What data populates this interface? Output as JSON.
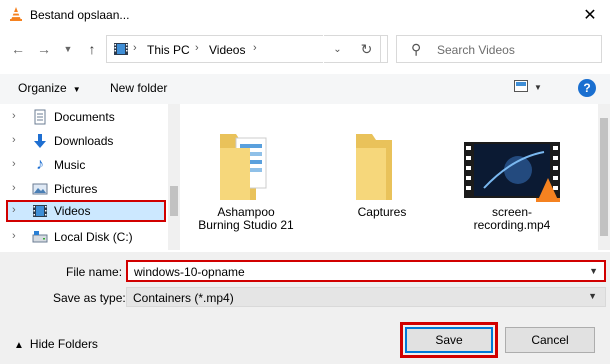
{
  "window": {
    "title": "Bestand opslaan..."
  },
  "address_bar": {
    "path": [
      "This PC",
      "Videos"
    ]
  },
  "search": {
    "placeholder": "Search Videos"
  },
  "toolbar": {
    "organize_label": "Organize",
    "new_folder_label": "New folder"
  },
  "sidebar": {
    "items": [
      {
        "label": "Documents",
        "icon": "documents-icon"
      },
      {
        "label": "Downloads",
        "icon": "downloads-icon"
      },
      {
        "label": "Music",
        "icon": "music-icon"
      },
      {
        "label": "Pictures",
        "icon": "pictures-icon"
      },
      {
        "label": "Videos",
        "icon": "videos-icon",
        "selected": true
      },
      {
        "label": "Local Disk (C:)",
        "icon": "local-disk-icon"
      }
    ]
  },
  "files": [
    {
      "name": "Ashampoo Burning Studio 21",
      "type": "folder-with-document"
    },
    {
      "name": "Captures",
      "type": "folder"
    },
    {
      "name": "screen-recording.mp4",
      "type": "video"
    }
  ],
  "form": {
    "file_name_label": "File name:",
    "file_name_value": "windows-10-opname",
    "save_as_type_label": "Save as type:",
    "save_as_type_value": "Containers (*.mp4)"
  },
  "footer": {
    "hide_folders_label": "Hide Folders",
    "save_label": "Save",
    "cancel_label": "Cancel"
  },
  "colors": {
    "highlight_red": "#d10000",
    "selection_blue": "#cce8ff",
    "accent_blue": "#0078d7"
  }
}
